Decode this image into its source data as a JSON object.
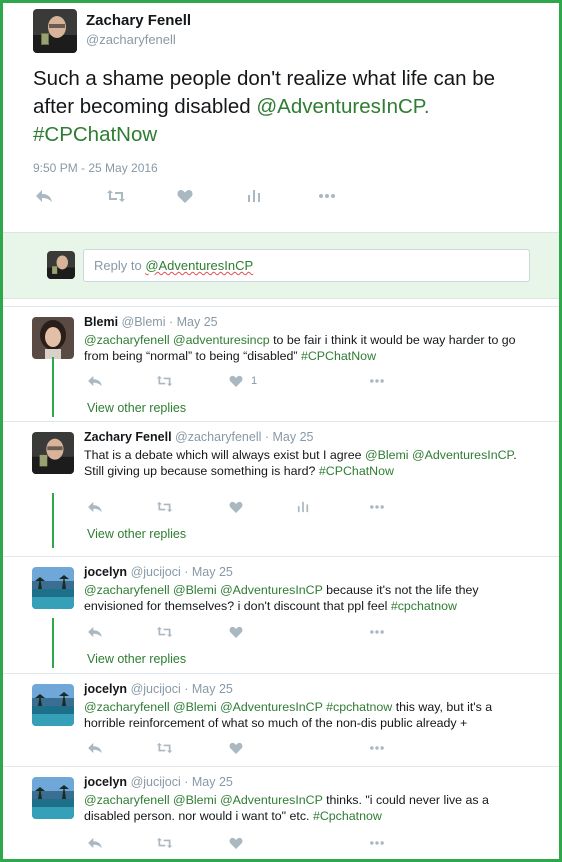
{
  "main_tweet": {
    "name": "Zachary Fenell",
    "handle": "@zacharyfenell",
    "text_plain": "Such a shame people don't realize what life can be after becoming disabled",
    "mention": "@AdventuresInCP.",
    "hashtag": "#CPChatNow",
    "timestamp": "9:50 PM - 25 May 2016",
    "icons": [
      "reply-icon",
      "retweet-icon",
      "like-icon",
      "analytics-icon",
      "more-icon"
    ]
  },
  "reply_box": {
    "prefix": "Reply to ",
    "mention": "@AdventuresInCP"
  },
  "replies": [
    {
      "name": "Blemi",
      "handle": "@Blemi",
      "date": "· May 25",
      "parts": [
        {
          "t": "@zacharyfenell",
          "link": true
        },
        {
          "t": " ",
          "link": false
        },
        {
          "t": "@adventuresincp",
          "link": true
        },
        {
          "t": " to be fair i think it would be way harder to go from being “normal” to being “disabled” ",
          "link": false
        },
        {
          "t": "#CPChatNow",
          "link": true
        }
      ],
      "likes": "1",
      "view_replies": "View other replies"
    },
    {
      "name": "Zachary Fenell",
      "handle": "@zacharyfenell",
      "date": "· May 25",
      "parts": [
        {
          "t": "That is a debate which will always exist but I agree ",
          "link": false
        },
        {
          "t": "@Blemi",
          "link": true
        },
        {
          "t": " ",
          "link": false
        },
        {
          "t": "@AdventuresInCP",
          "link": true
        },
        {
          "t": ". Still giving up because something is hard? ",
          "link": false
        },
        {
          "t": "#CPChatNow",
          "link": true
        }
      ],
      "view_replies": "View other replies"
    },
    {
      "name": "jocelyn",
      "handle": "@jucijoci",
      "date": "· May 25",
      "parts": [
        {
          "t": "@zacharyfenell",
          "link": true
        },
        {
          "t": " ",
          "link": false
        },
        {
          "t": "@Blemi",
          "link": true
        },
        {
          "t": " ",
          "link": false
        },
        {
          "t": "@AdventuresInCP",
          "link": true
        },
        {
          "t": " because it's not the life they envisioned for themselves? i don't discount that ppl feel ",
          "link": false
        },
        {
          "t": "#cpchatnow",
          "link": true
        }
      ],
      "view_replies": "View other replies"
    },
    {
      "name": "jocelyn",
      "handle": "@jucijoci",
      "date": "· May 25",
      "parts": [
        {
          "t": "@zacharyfenell",
          "link": true
        },
        {
          "t": " ",
          "link": false
        },
        {
          "t": "@Blemi",
          "link": true
        },
        {
          "t": " ",
          "link": false
        },
        {
          "t": "@AdventuresInCP",
          "link": true
        },
        {
          "t": " ",
          "link": false
        },
        {
          "t": "#cpchatnow",
          "link": true
        },
        {
          "t": " this way, but it's a horrible reinforcement of what so much of the non-dis public already +",
          "link": false
        }
      ]
    },
    {
      "name": "jocelyn",
      "handle": "@jucijoci",
      "date": "· May 25",
      "parts": [
        {
          "t": "@zacharyfenell",
          "link": true
        },
        {
          "t": " ",
          "link": false
        },
        {
          "t": "@Blemi",
          "link": true
        },
        {
          "t": " ",
          "link": false
        },
        {
          "t": "@AdventuresInCP",
          "link": true
        },
        {
          "t": " thinks. \"i could never live as a disabled person. nor would i want to\" etc. ",
          "link": false
        },
        {
          "t": "#Cpchatnow",
          "link": true
        }
      ]
    }
  ],
  "colors": {
    "frame": "#2ea84a",
    "link": "#2e7d32",
    "muted": "#8899a6",
    "icon": "#aab8c2",
    "reply_bar_bg": "#e8f5e9"
  }
}
